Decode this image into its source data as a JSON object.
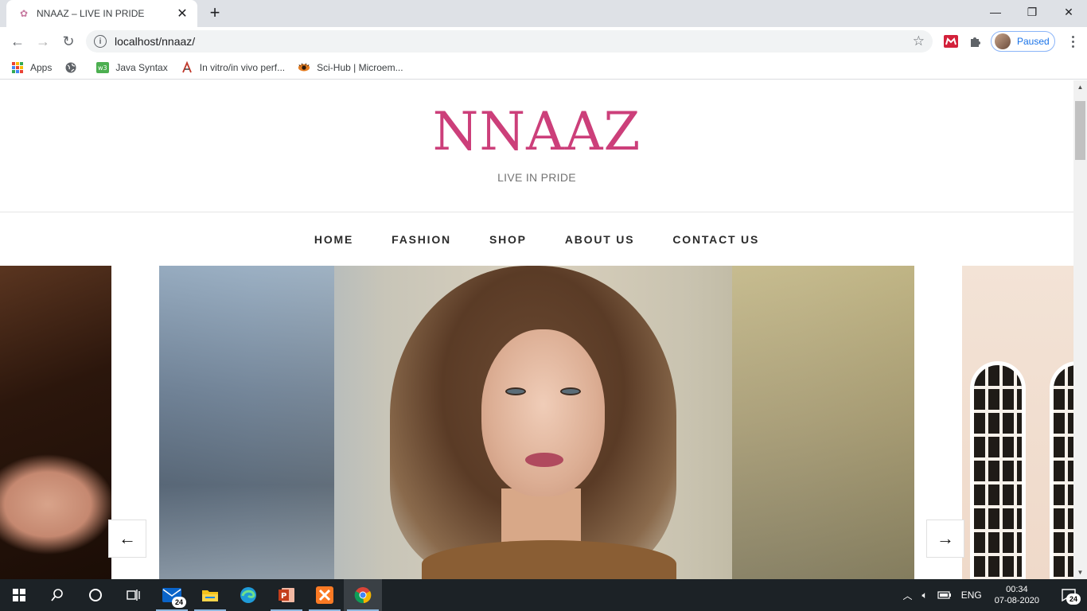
{
  "browser": {
    "tab_title": "NNAAZ – LIVE IN PRIDE",
    "new_tab": "+",
    "url": "localhost/nnaaz/",
    "profile_status": "Paused",
    "bookmarks": [
      {
        "label": "Apps"
      },
      {
        "label": ""
      },
      {
        "label": "Java Syntax"
      },
      {
        "label": "In vitro/in vivo perf..."
      },
      {
        "label": "Sci-Hub | Microem..."
      }
    ]
  },
  "site": {
    "title": "NNAAZ",
    "tagline": "LIVE IN PRIDE",
    "nav": [
      "HOME",
      "FASHION",
      "SHOP",
      "ABOUT US",
      "CONTACT US"
    ],
    "slider": {
      "prev_arrow": "←",
      "next_arrow": "→"
    }
  },
  "taskbar": {
    "mail_badge": "24",
    "language": "ENG",
    "time": "00:34",
    "date": "07-08-2020",
    "notifications_badge": "24"
  },
  "colors": {
    "brand": "#cc3f7a",
    "chrome_tabbar": "#dee1e6",
    "taskbar": "#1c2226"
  }
}
